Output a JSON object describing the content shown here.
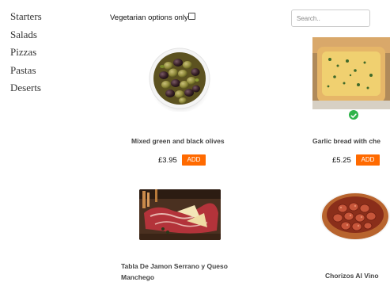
{
  "sidebar": {
    "items": [
      {
        "label": "Starters"
      },
      {
        "label": "Salads"
      },
      {
        "label": "Pizzas"
      },
      {
        "label": "Pastas"
      },
      {
        "label": "Deserts"
      }
    ]
  },
  "filter": {
    "vegetarian_label": "Vegetarian options only",
    "vegetarian_checked": false
  },
  "search": {
    "placeholder": "Search.."
  },
  "products": [
    {
      "name": "Mixed green and black olives",
      "price": "£3.95",
      "add_label": "ADD"
    },
    {
      "name": "Garlic bread with che",
      "price": "£5.25",
      "add_label": "ADD",
      "vegetarian_badge": "check-icon"
    },
    {
      "name": "Tabla De Jamon Serrano y Queso Manchego"
    },
    {
      "name": "Chorizos Al Vino"
    }
  ],
  "colors": {
    "add_button": "#ff6a00",
    "badge": "#2fb34a"
  }
}
